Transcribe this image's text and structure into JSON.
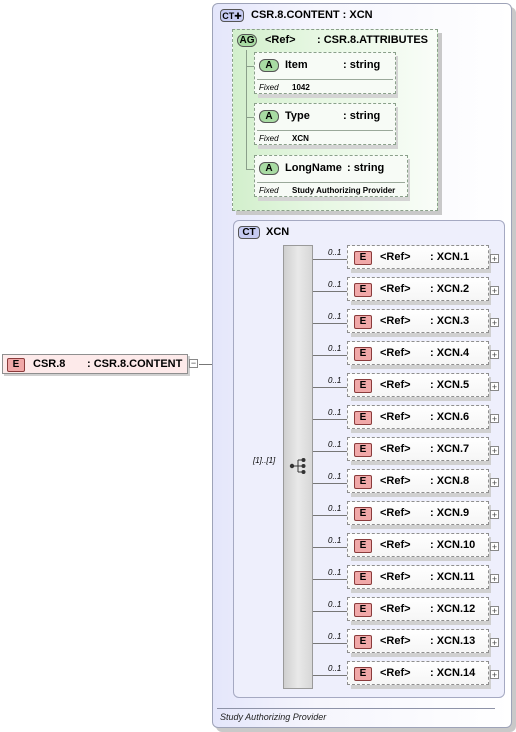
{
  "root_element": {
    "badge": "E",
    "name": "CSR.8",
    "type": ": CSR.8.CONTENT"
  },
  "complex_type": {
    "badge": "CT",
    "title": "CSR.8.CONTENT : XCN",
    "documentation": "Study Authorizing Provider"
  },
  "attribute_group": {
    "badge": "AG",
    "ref": "<Ref>",
    "type": ": CSR.8.ATTRIBUTES",
    "attributes": [
      {
        "badge": "A",
        "name": "Item",
        "type": ": string",
        "fixed_label": "Fixed",
        "fixed_value": "1042"
      },
      {
        "badge": "A",
        "name": "Type",
        "type": ": string",
        "fixed_label": "Fixed",
        "fixed_value": "XCN"
      },
      {
        "badge": "A",
        "name": "LongName",
        "type": ": string",
        "fixed_label": "Fixed",
        "fixed_value": "Study Authorizing Provider"
      }
    ]
  },
  "inner_type": {
    "badge": "CT",
    "title": "XCN",
    "sequence_cardinality": "[1]..[1]"
  },
  "elements": [
    {
      "badge": "E",
      "ref": "<Ref>",
      "type": ": XCN.1",
      "cardinality": "0..1"
    },
    {
      "badge": "E",
      "ref": "<Ref>",
      "type": ": XCN.2",
      "cardinality": "0..1"
    },
    {
      "badge": "E",
      "ref": "<Ref>",
      "type": ": XCN.3",
      "cardinality": "0..1"
    },
    {
      "badge": "E",
      "ref": "<Ref>",
      "type": ": XCN.4",
      "cardinality": "0..1"
    },
    {
      "badge": "E",
      "ref": "<Ref>",
      "type": ": XCN.5",
      "cardinality": "0..1"
    },
    {
      "badge": "E",
      "ref": "<Ref>",
      "type": ": XCN.6",
      "cardinality": "0..1"
    },
    {
      "badge": "E",
      "ref": "<Ref>",
      "type": ": XCN.7",
      "cardinality": "0..1"
    },
    {
      "badge": "E",
      "ref": "<Ref>",
      "type": ": XCN.8",
      "cardinality": "0..1"
    },
    {
      "badge": "E",
      "ref": "<Ref>",
      "type": ": XCN.9",
      "cardinality": "0..1"
    },
    {
      "badge": "E",
      "ref": "<Ref>",
      "type": ": XCN.10",
      "cardinality": "0..1"
    },
    {
      "badge": "E",
      "ref": "<Ref>",
      "type": ": XCN.11",
      "cardinality": "0..1"
    },
    {
      "badge": "E",
      "ref": "<Ref>",
      "type": ": XCN.12",
      "cardinality": "0..1"
    },
    {
      "badge": "E",
      "ref": "<Ref>",
      "type": ": XCN.13",
      "cardinality": "0..1"
    },
    {
      "badge": "E",
      "ref": "<Ref>",
      "type": ": XCN.14",
      "cardinality": "0..1"
    }
  ]
}
